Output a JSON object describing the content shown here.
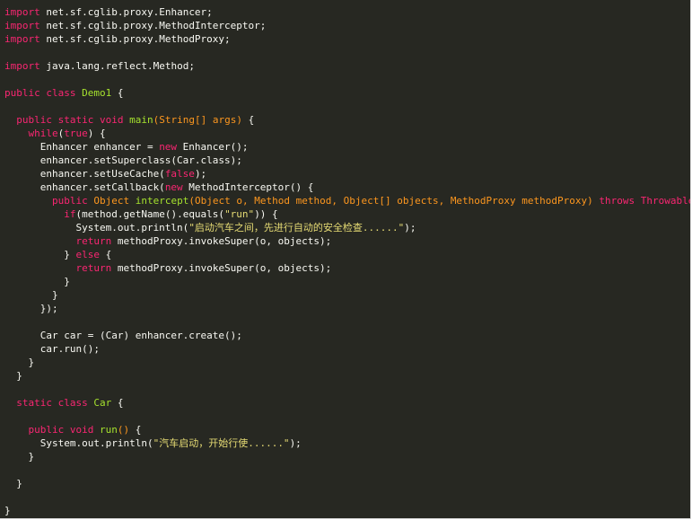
{
  "theme": {
    "background": "#272822",
    "colors": {
      "plain": "#f8f8f2",
      "keyword": "#f92672",
      "function": "#a6e22e",
      "type": "#fd971f",
      "param": "#fd971f",
      "string": "#e6db74",
      "constant": "#ae81ff"
    }
  },
  "code": {
    "language": "java",
    "lines": [
      [
        [
          "keyword",
          "import"
        ],
        [
          "plain",
          " net.sf.cglib.proxy.Enhancer;"
        ]
      ],
      [
        [
          "keyword",
          "import"
        ],
        [
          "plain",
          " net.sf.cglib.proxy.MethodInterceptor;"
        ]
      ],
      [
        [
          "keyword",
          "import"
        ],
        [
          "plain",
          " net.sf.cglib.proxy.MethodProxy;"
        ]
      ],
      [],
      [
        [
          "keyword",
          "import"
        ],
        [
          "plain",
          " java.lang.reflect.Method;"
        ]
      ],
      [],
      [
        [
          "keyword",
          "public class"
        ],
        [
          "plain",
          " "
        ],
        [
          "function",
          "Demo1"
        ],
        [
          "plain",
          " {"
        ]
      ],
      [],
      [
        [
          "plain",
          "  "
        ],
        [
          "keyword",
          "public static void"
        ],
        [
          "plain",
          " "
        ],
        [
          "function",
          "main"
        ],
        [
          "type",
          "("
        ],
        [
          "type",
          "String[]"
        ],
        [
          "plain",
          " "
        ],
        [
          "param",
          "args"
        ],
        [
          "type",
          ")"
        ],
        [
          "plain",
          " {"
        ]
      ],
      [
        [
          "plain",
          "    "
        ],
        [
          "keyword",
          "while"
        ],
        [
          "plain",
          "("
        ],
        [
          "keyword",
          "true"
        ],
        [
          "plain",
          ") {"
        ]
      ],
      [
        [
          "plain",
          "      Enhancer enhancer = "
        ],
        [
          "keyword",
          "new"
        ],
        [
          "plain",
          " Enhancer();"
        ]
      ],
      [
        [
          "plain",
          "      enhancer.setSuperclass(Car.class);"
        ]
      ],
      [
        [
          "plain",
          "      enhancer.setUseCache("
        ],
        [
          "keyword",
          "false"
        ],
        [
          "plain",
          ");"
        ]
      ],
      [
        [
          "plain",
          "      enhancer.setCallback("
        ],
        [
          "keyword",
          "new"
        ],
        [
          "plain",
          " MethodInterceptor() {"
        ]
      ],
      [
        [
          "plain",
          "        "
        ],
        [
          "keyword",
          "public"
        ],
        [
          "plain",
          " "
        ],
        [
          "type",
          "Object"
        ],
        [
          "plain",
          " "
        ],
        [
          "function",
          "intercept"
        ],
        [
          "type",
          "("
        ],
        [
          "type",
          "Object"
        ],
        [
          "plain",
          " "
        ],
        [
          "param",
          "o"
        ],
        [
          "type",
          ", "
        ],
        [
          "type",
          "Method"
        ],
        [
          "plain",
          " "
        ],
        [
          "param",
          "method"
        ],
        [
          "type",
          ", "
        ],
        [
          "type",
          "Object[]"
        ],
        [
          "plain",
          " "
        ],
        [
          "param",
          "objects"
        ],
        [
          "type",
          ", "
        ],
        [
          "type",
          "MethodProxy"
        ],
        [
          "plain",
          " "
        ],
        [
          "param",
          "methodProxy"
        ],
        [
          "type",
          ")"
        ],
        [
          "plain",
          " "
        ],
        [
          "keyword",
          "throws"
        ],
        [
          "plain",
          " "
        ],
        [
          "keyword",
          "Throwable"
        ],
        [
          "plain",
          " {"
        ]
      ],
      [
        [
          "plain",
          "          "
        ],
        [
          "keyword",
          "if"
        ],
        [
          "plain",
          "(method.getName().equals("
        ],
        [
          "string",
          "\"run\""
        ],
        [
          "plain",
          ")) {"
        ]
      ],
      [
        [
          "plain",
          "            System.out.println("
        ],
        [
          "string",
          "\"启动汽车之间，先进行自动的安全检查......\""
        ],
        [
          "plain",
          ");"
        ]
      ],
      [
        [
          "plain",
          "            "
        ],
        [
          "keyword",
          "return"
        ],
        [
          "plain",
          " methodProxy.invokeSuper(o, objects);"
        ]
      ],
      [
        [
          "plain",
          "          } "
        ],
        [
          "keyword",
          "else"
        ],
        [
          "plain",
          " {"
        ]
      ],
      [
        [
          "plain",
          "            "
        ],
        [
          "keyword",
          "return"
        ],
        [
          "plain",
          " methodProxy.invokeSuper(o, objects);"
        ]
      ],
      [
        [
          "plain",
          "          }"
        ]
      ],
      [
        [
          "plain",
          "        }"
        ]
      ],
      [
        [
          "plain",
          "      });"
        ]
      ],
      [],
      [
        [
          "plain",
          "      Car car = (Car) enhancer.create();"
        ]
      ],
      [
        [
          "plain",
          "      car.run();"
        ]
      ],
      [
        [
          "plain",
          "    }"
        ]
      ],
      [
        [
          "plain",
          "  }"
        ]
      ],
      [],
      [
        [
          "plain",
          "  "
        ],
        [
          "keyword",
          "static class"
        ],
        [
          "plain",
          " "
        ],
        [
          "function",
          "Car"
        ],
        [
          "plain",
          " {"
        ]
      ],
      [],
      [
        [
          "plain",
          "    "
        ],
        [
          "keyword",
          "public void"
        ],
        [
          "plain",
          " "
        ],
        [
          "function",
          "run"
        ],
        [
          "type",
          "()"
        ],
        [
          "plain",
          " {"
        ]
      ],
      [
        [
          "plain",
          "      System.out.println("
        ],
        [
          "string",
          "\"汽车启动，开始行使......\""
        ],
        [
          "plain",
          ");"
        ]
      ],
      [
        [
          "plain",
          "    }"
        ]
      ],
      [],
      [
        [
          "plain",
          "  }"
        ]
      ],
      [],
      [
        [
          "plain",
          "}"
        ]
      ]
    ]
  }
}
